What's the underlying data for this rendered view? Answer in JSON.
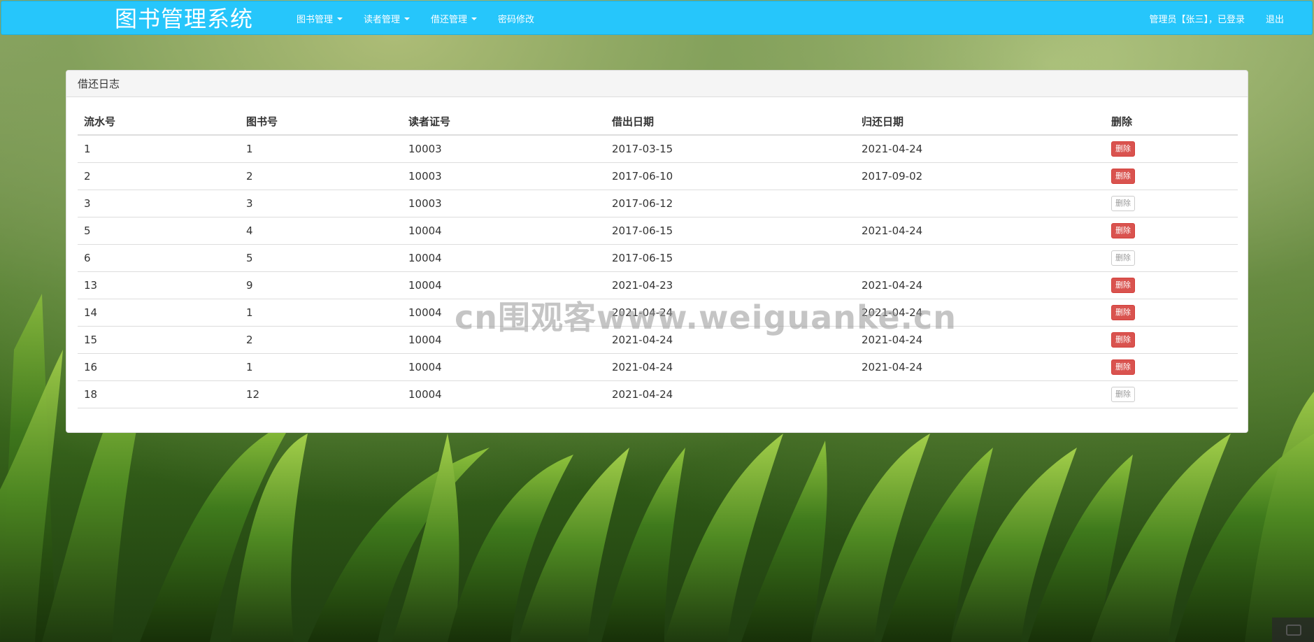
{
  "navbar": {
    "brand": "图书管理系统",
    "menu": [
      {
        "label": "图书管理",
        "dropdown": true
      },
      {
        "label": "读者管理",
        "dropdown": true
      },
      {
        "label": "借还管理",
        "dropdown": true
      },
      {
        "label": "密码修改",
        "dropdown": false
      }
    ],
    "user_status": "管理员【张三】，已登录",
    "logout": "退出"
  },
  "panel": {
    "title": "借还日志",
    "columns": [
      "流水号",
      "图书号",
      "读者证号",
      "借出日期",
      "归还日期",
      "删除"
    ],
    "rows": [
      {
        "serial": "1",
        "book": "1",
        "reader": "10003",
        "lend_date": "2017-03-15",
        "return_date": "2021-04-24",
        "delete": "删除",
        "delete_enabled": true
      },
      {
        "serial": "2",
        "book": "2",
        "reader": "10003",
        "lend_date": "2017-06-10",
        "return_date": "2017-09-02",
        "delete": "删除",
        "delete_enabled": true
      },
      {
        "serial": "3",
        "book": "3",
        "reader": "10003",
        "lend_date": "2017-06-12",
        "return_date": "",
        "delete": "删除",
        "delete_enabled": false
      },
      {
        "serial": "5",
        "book": "4",
        "reader": "10004",
        "lend_date": "2017-06-15",
        "return_date": "2021-04-24",
        "delete": "删除",
        "delete_enabled": true
      },
      {
        "serial": "6",
        "book": "5",
        "reader": "10004",
        "lend_date": "2017-06-15",
        "return_date": "",
        "delete": "删除",
        "delete_enabled": false
      },
      {
        "serial": "13",
        "book": "9",
        "reader": "10004",
        "lend_date": "2021-04-23",
        "return_date": "2021-04-24",
        "delete": "删除",
        "delete_enabled": true
      },
      {
        "serial": "14",
        "book": "1",
        "reader": "10004",
        "lend_date": "2021-04-24",
        "return_date": "2021-04-24",
        "delete": "删除",
        "delete_enabled": true
      },
      {
        "serial": "15",
        "book": "2",
        "reader": "10004",
        "lend_date": "2021-04-24",
        "return_date": "2021-04-24",
        "delete": "删除",
        "delete_enabled": true
      },
      {
        "serial": "16",
        "book": "1",
        "reader": "10004",
        "lend_date": "2021-04-24",
        "return_date": "2021-04-24",
        "delete": "删除",
        "delete_enabled": true
      },
      {
        "serial": "18",
        "book": "12",
        "reader": "10004",
        "lend_date": "2021-04-24",
        "return_date": "",
        "delete": "删除",
        "delete_enabled": false
      }
    ]
  },
  "watermark": "cn围观客www.weiguanke.cn",
  "colors": {
    "navbar": "#26c6fb",
    "delete_active": "#d9534f",
    "background": "#4d7a2a"
  }
}
